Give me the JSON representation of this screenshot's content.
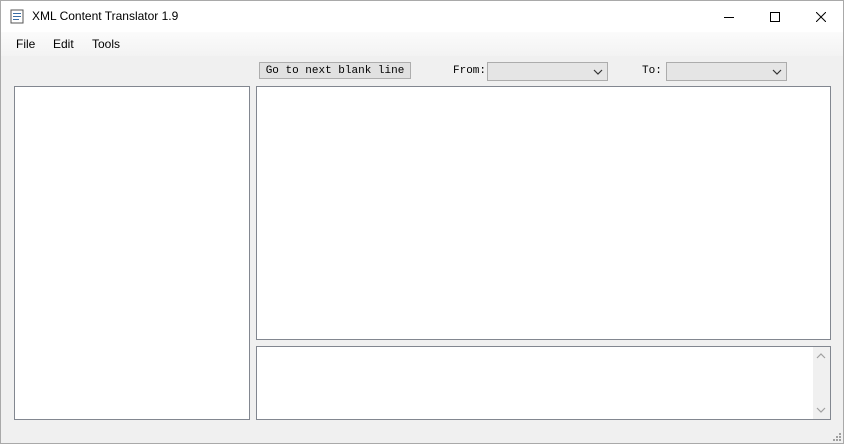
{
  "window": {
    "title": "XML Content Translator 1.9",
    "controls": {
      "minimize": "minimize-icon",
      "maximize": "maximize-icon",
      "close": "close-icon"
    }
  },
  "menu": {
    "file": "File",
    "edit": "Edit",
    "tools": "Tools"
  },
  "toolbar": {
    "next_blank_label": "Go to next blank line",
    "from_label": "From:",
    "from_value": "",
    "to_label": "To:",
    "to_value": ""
  },
  "panels": {
    "tree_content": "",
    "source_text": "",
    "translation_text": ""
  },
  "colors": {
    "window_bg": "#f0f0f0",
    "panel_bg": "#ffffff",
    "panel_border": "#828790",
    "button_bg": "#e1e1e1"
  }
}
